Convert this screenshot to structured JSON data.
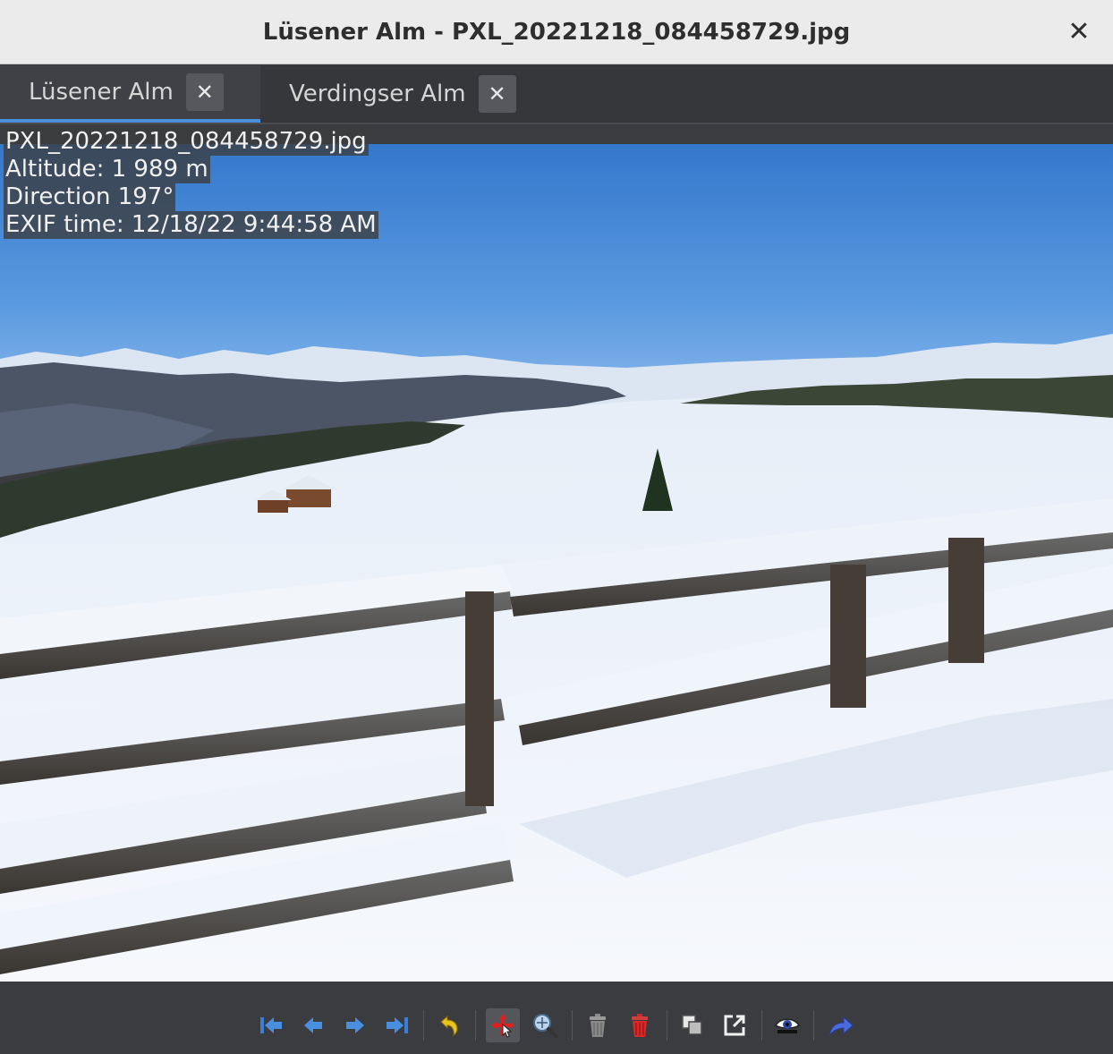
{
  "window": {
    "title": "Lüsener Alm - PXL_20221218_084458729.jpg",
    "close_glyph": "✕"
  },
  "tabs": [
    {
      "label": "Lüsener Alm",
      "active": true,
      "close_glyph": "✕"
    },
    {
      "label": "Verdingser Alm",
      "active": false,
      "close_glyph": "✕"
    }
  ],
  "photo_info": {
    "filename": "PXL_20221218_084458729.jpg",
    "altitude": "Altitude: 1 989 m",
    "direction": "Direction 197°",
    "exif_time": "EXIF time: 12/18/22 9:44:58 AM"
  },
  "toolbar": {
    "buttons": [
      {
        "icon": "first-image-icon"
      },
      {
        "icon": "previous-image-icon"
      },
      {
        "icon": "next-image-icon"
      },
      {
        "icon": "last-image-icon"
      },
      {
        "icon": "undo-icon"
      },
      {
        "icon": "center-view-icon",
        "pressed": true
      },
      {
        "icon": "zoom-best-fit-icon"
      },
      {
        "icon": "delete-icon"
      },
      {
        "icon": "delete-from-disk-icon"
      },
      {
        "icon": "copy-icon"
      },
      {
        "icon": "open-external-icon"
      },
      {
        "icon": "show-info-icon"
      },
      {
        "icon": "move-to-icon"
      }
    ]
  },
  "colors": {
    "accent": "#4a90d9",
    "titlebar_bg": "#ebebeb",
    "window_bg": "#3a3c40"
  }
}
